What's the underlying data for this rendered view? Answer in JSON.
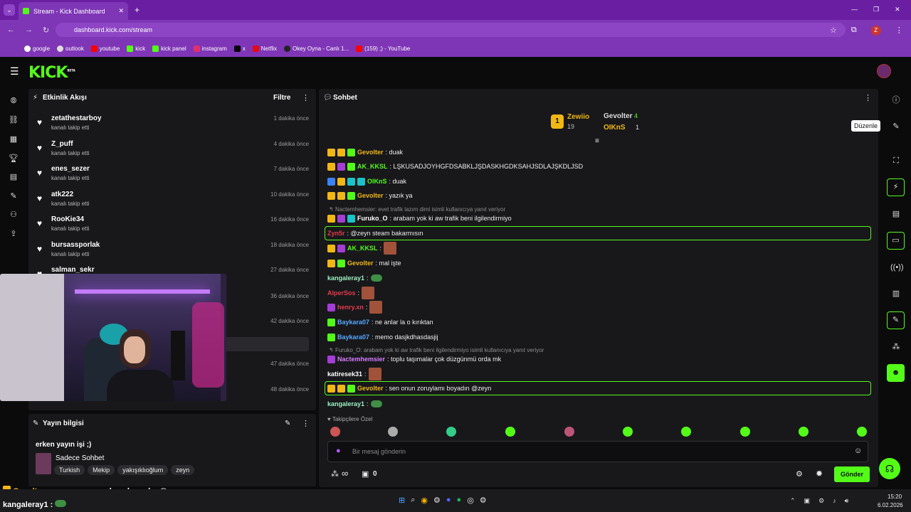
{
  "browser": {
    "tab_title": "Stream - Kick Dashboard",
    "url": "dashboard.kick.com/stream",
    "bookmarks": [
      "google",
      "outlook",
      "youtube",
      "kick",
      "kick panel",
      "instagram",
      "x",
      "Netflix",
      "Okey Oyna - Canlı 1...",
      "(159) ;) - YouTube"
    ]
  },
  "header": {
    "logo": "KICK",
    "beta": "BETA"
  },
  "activity": {
    "title": "Etkinlik Akışı",
    "filter": "Filtre",
    "items": [
      {
        "name": "zetathestarboy",
        "action": "kanalı takip etti",
        "time": "1 dakika önce"
      },
      {
        "name": "Z_puff",
        "action": "kanalı takip etti",
        "time": "4 dakika önce"
      },
      {
        "name": "enes_sezer",
        "action": "kanalı takip etti",
        "time": "7 dakika önce"
      },
      {
        "name": "atk222",
        "action": "kanalı takip etti",
        "time": "10 dakika önce"
      },
      {
        "name": "RooKie34",
        "action": "kanalı takip etti",
        "time": "16 dakika önce"
      },
      {
        "name": "bursassporlak",
        "action": "kanalı takip etti",
        "time": "18 dakika önce"
      },
      {
        "name": "salman_sekr",
        "action": "",
        "time": "27 dakika önce"
      }
    ],
    "extra_times": [
      "36 dakika önce",
      "42 dakika önce",
      "47 dakika önce",
      "48 dakika önce"
    ]
  },
  "info": {
    "title": "Yayın bilgisi",
    "stream_title": "erken yayın işi ;)",
    "category": "Sadece Sohbet",
    "tags": [
      "Turkish",
      "Mekip",
      "yakışıklıoğlum",
      "zeyn"
    ]
  },
  "chat": {
    "title": "Sohbet",
    "leaderboard": {
      "first": {
        "name": "Zewiio",
        "count": "19"
      },
      "second": {
        "name": "Gevolter",
        "count": "4"
      },
      "third": {
        "name": "OIKnS",
        "count": "1"
      }
    },
    "messages": [
      {
        "user": "Gevolter",
        "color": "#f1b714",
        "text": ": duak"
      },
      {
        "user": "AK_KKSL",
        "color": "#53fc18",
        "text": ": LŞKUSADJOYHGFDSABKLJŞDASKHGDKSAHJSDLAJŞKDLJSD"
      },
      {
        "user": "OIKnS",
        "color": "#53fc18",
        "text": ": duak"
      },
      {
        "user": "Gevolter",
        "color": "#f1b714",
        "text": ": yazık ya"
      },
      {
        "reply": "Nactemhemsier: evet trafik lazım dimi  isimli kullanıcıya yanıt veriyor"
      },
      {
        "user": "Furuko_O",
        "color": "#ffffff",
        "text": ": arabam yok ki aw trafik beni ilgilendirmiyo"
      },
      {
        "user": "Zyn5r",
        "color": "#e5394b",
        "text": ": @zeyn steam bakarmısın"
      },
      {
        "user": "AK_KKSL",
        "color": "#53fc18",
        "text": ":"
      },
      {
        "user": "Gevolter",
        "color": "#f1b714",
        "text": ": mal işte"
      },
      {
        "user": "kangaleray1",
        "color": "#9bf0c0",
        "text": ":"
      },
      {
        "user": "AlperSos",
        "color": "#e5394b",
        "text": ":"
      },
      {
        "user": "henry.xn",
        "color": "#e5394b",
        "text": ":"
      },
      {
        "user": "Baykara07",
        "color": "#56a8ff",
        "text": ": ne anlar la o kırıktan"
      },
      {
        "user": "Baykara07",
        "color": "#56a8ff",
        "text": ": memo dasjkdhasdasjij"
      },
      {
        "reply": "Furuko_O: arabam yok ki aw trafik beni ilgilendirmiyo isimli kullanıcıya yanıt veriyor"
      },
      {
        "user": "Nactemhemsier",
        "color": "#d67cff",
        "text": ": toplu taşımalar çok düzgünmü orda mk"
      },
      {
        "user": "katiresek31",
        "color": "#ffffff",
        "text": ":"
      },
      {
        "user": "Gevolter",
        "color": "#f1b714",
        "text": ": sen onun zoruylamı boyadın @zeyn"
      },
      {
        "user": "kangaleray1",
        "color": "#9bf0c0",
        "text": ":"
      }
    ],
    "followers_only": "Takipçilere Özel",
    "placeholder": "Bir mesaj gönderin",
    "infinity": "∞",
    "count": "0",
    "send": "Gönder"
  },
  "tooltip": "Düzenle",
  "overlay": {
    "line1_user": "Gevolter",
    "line1_text": " : sen onun zoruylamı boyadın @zeyn",
    "line2_user": "kangaleray1 :"
  },
  "taskbar": {
    "time": "15:20",
    "date": "6.02.2026"
  }
}
